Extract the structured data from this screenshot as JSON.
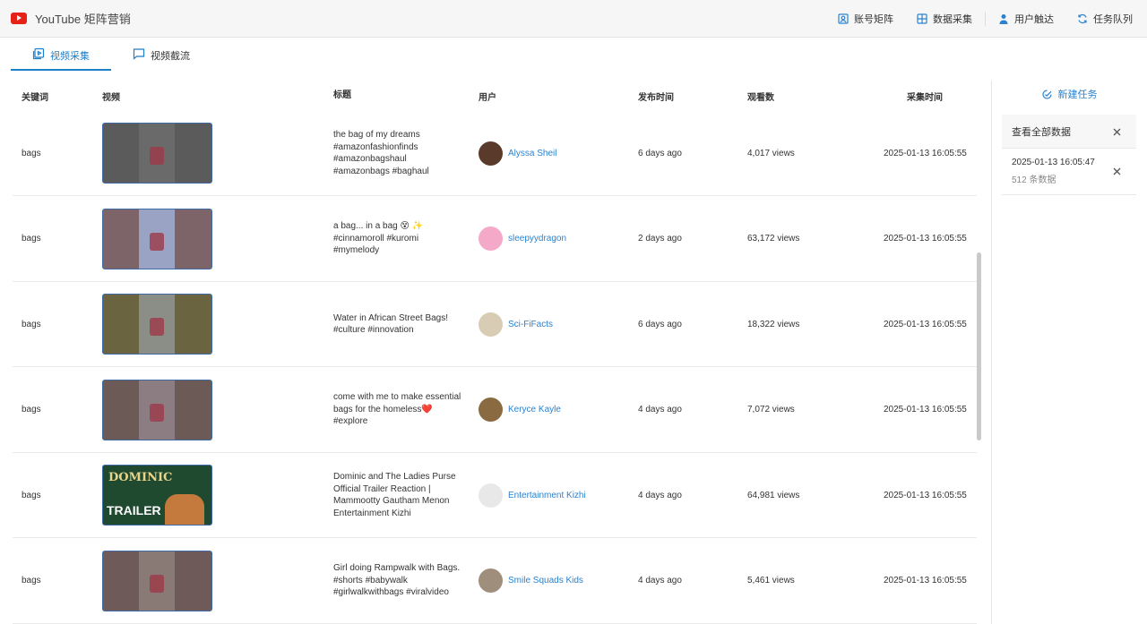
{
  "app": {
    "title": "YouTube 矩阵营销"
  },
  "nav": [
    {
      "label": "账号矩阵",
      "icon": "account-icon"
    },
    {
      "label": "数据采集",
      "icon": "grid-icon"
    },
    {
      "label": "用户触达",
      "icon": "user-icon"
    },
    {
      "label": "任务队列",
      "icon": "refresh-icon"
    }
  ],
  "tabs": [
    {
      "label": "视频采集",
      "active": true
    },
    {
      "label": "视频截流",
      "active": false
    }
  ],
  "table": {
    "headers": [
      "关键词",
      "视频",
      "标题",
      "用户",
      "发布时间",
      "观看数",
      "采集时间"
    ],
    "rows": [
      {
        "keyword": "bags",
        "title": "the bag of my dreams #amazonfashionfinds #amazonbagshaul #amazonbags #baghaul",
        "user": "Alyssa Sheil",
        "published": "6 days ago",
        "views": "4,017 views",
        "collected": "2025-01-13 16:05:55",
        "thumb": "#5b5b5b",
        "thumb_inner": "#6a6a6a",
        "avatar": "#5a3a2a"
      },
      {
        "keyword": "bags",
        "title": "a bag... in a bag 😵 ✨ #cinnamoroll #kuromi #mymelody",
        "user": "sleepyydragon",
        "published": "2 days ago",
        "views": "63,172 views",
        "collected": "2025-01-13 16:05:55",
        "thumb": "#7c6468",
        "thumb_inner": "#9aa3c3",
        "avatar": "#f4a9c8"
      },
      {
        "keyword": "bags",
        "title": "Water in African Street Bags! #culture #innovation",
        "user": "Sci-FiFacts",
        "published": "6 days ago",
        "views": "18,322 views",
        "collected": "2025-01-13 16:05:55",
        "thumb": "#6b6440",
        "thumb_inner": "#8a8e86",
        "avatar": "#d8cdb4"
      },
      {
        "keyword": "bags",
        "title": "come with me to make essential bags for the homeless❤️ #explore",
        "user": "Keryce Kayle",
        "published": "4 days ago",
        "views": "7,072 views",
        "collected": "2025-01-13 16:05:55",
        "thumb": "#6b5a55",
        "thumb_inner": "#8c7d82",
        "avatar": "#8a6a40"
      },
      {
        "keyword": "bags",
        "title": "Dominic and The Ladies Purse Official Trailer Reaction | Mammootty Gautham Menon Entertainment Kizhi",
        "user": "Entertainment Kizhi",
        "published": "4 days ago",
        "views": "64,981 views",
        "collected": "2025-01-13 16:05:55",
        "thumb": "#1f4a30",
        "thumb_inner": "#2b5d3c",
        "avatar": "#e8e8e8",
        "thumb_text": "DOMINIC",
        "thumb_sub": "TRAILER"
      },
      {
        "keyword": "bags",
        "title": "Girl doing Rampwalk with Bags. #shorts #babywalk #girlwalkwithbags #viralvideo",
        "user": "Smile Squads Kids",
        "published": "4 days ago",
        "views": "5,461 views",
        "collected": "2025-01-13 16:05:55",
        "thumb": "#6e5a58",
        "thumb_inner": "#8a7a76",
        "avatar": "#a08e7c"
      }
    ]
  },
  "side": {
    "new_task": "新建任务",
    "all_data": "查看全部数据",
    "tasks": [
      {
        "time": "2025-01-13 16:05:47",
        "count": "512 条数据"
      }
    ]
  },
  "colors": {
    "accent": "#2b82cf",
    "tab_active": "#1e7fc9",
    "logo": "#e62117"
  }
}
